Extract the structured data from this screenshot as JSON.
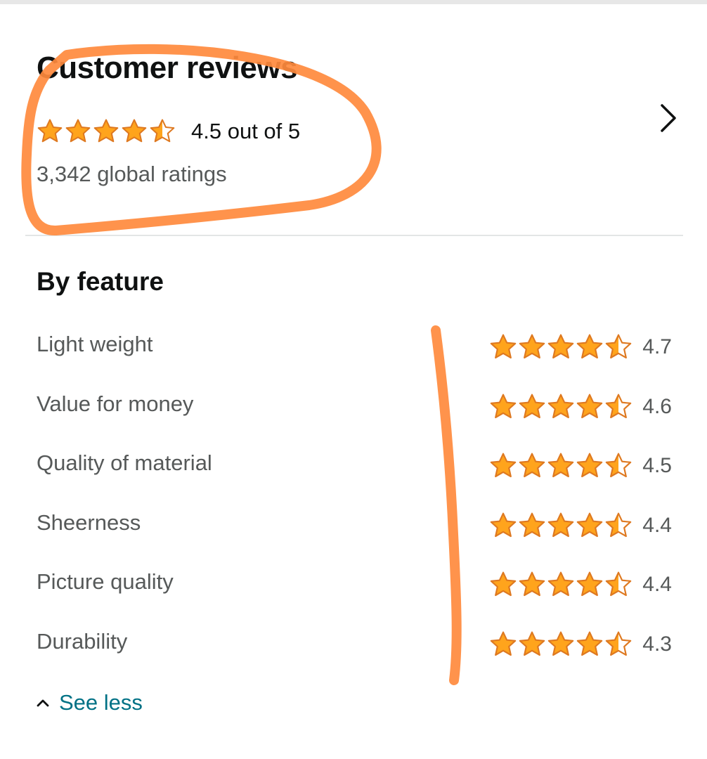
{
  "reviews": {
    "title": "Customer reviews",
    "rating": 4.5,
    "rating_text": "4.5 out of 5",
    "global_ratings": "3,342 global ratings"
  },
  "by_feature": {
    "title": "By feature",
    "features": [
      {
        "label": "Light weight",
        "score": "4.7",
        "value": 4.7
      },
      {
        "label": "Value for money",
        "score": "4.6",
        "value": 4.6
      },
      {
        "label": "Quality of material",
        "score": "4.5",
        "value": 4.5
      },
      {
        "label": "Sheerness",
        "score": "4.4",
        "value": 4.4
      },
      {
        "label": "Picture quality",
        "score": "4.4",
        "value": 4.4
      },
      {
        "label": "Durability",
        "score": "4.3",
        "value": 4.3
      }
    ],
    "see_less": "See less"
  },
  "icons": {
    "star": "star-icon",
    "chevron": "chevron-right-icon",
    "caret": "chevron-up-icon"
  },
  "colors": {
    "star_fill": "#FFA41C",
    "star_stroke": "#DE7921",
    "link": "#007185",
    "annotation": "#FF8A3D"
  }
}
